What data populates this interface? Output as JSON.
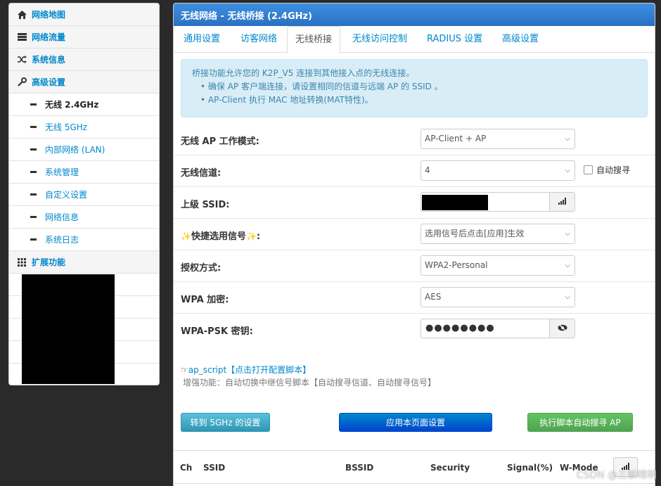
{
  "sidebar": {
    "sections": [
      {
        "label": "网络地图",
        "icon": "home-icon"
      },
      {
        "label": "网络流量",
        "icon": "list-icon"
      },
      {
        "label": "系统信息",
        "icon": "shuffle-icon"
      },
      {
        "label": "高级设置",
        "icon": "wrench-icon"
      }
    ],
    "sub_items": [
      {
        "label": "无线 2.4GHz",
        "active": true
      },
      {
        "label": "无线 5GHz"
      },
      {
        "label": "内部网络 (LAN)"
      },
      {
        "label": "系统管理"
      },
      {
        "label": "自定义设置"
      },
      {
        "label": "网络信息"
      },
      {
        "label": "系统日志"
      }
    ],
    "extension": {
      "label": "扩展功能",
      "icon": "grid-icon"
    }
  },
  "panel": {
    "title": "无线网络 - 无线桥接 (2.4GHz)",
    "tabs": [
      "通用设置",
      "访客网络",
      "无线桥接",
      "无线访问控制",
      "RADIUS 设置",
      "高级设置"
    ],
    "active_tab": "无线桥接"
  },
  "info": {
    "line1": "桥接功能允许您的 K2P_V5 连接到其他接入点的无线连接。",
    "bullet1": "确保 AP 客户端连接，请设置相同的信道与远端 AP 的 SSID 。",
    "bullet2": "AP-Client 执行 MAC 地址转换(MAT特性)。"
  },
  "form": {
    "mode_label": "无线 AP 工作模式:",
    "mode_value": "AP-Client + AP",
    "channel_label": "无线信道:",
    "channel_value": "4",
    "auto_search_label": "自动搜寻",
    "ssid_label": "上级 SSID:",
    "quick_label": "快捷选用信号",
    "quick_colon": ":",
    "quick_value": "选用信号后点击[应用]生效",
    "auth_label": "授权方式:",
    "auth_value": "WPA2-Personal",
    "wpa_label": "WPA 加密:",
    "wpa_value": "AES",
    "psk_label": "WPA-PSK 密钥:",
    "psk_value": "●●●●●●●●"
  },
  "script": {
    "link": "ap_script【点击打开配置脚本】",
    "desc": "增强功能：自动切换中继信号脚本【自动搜寻信道、自动搜寻信号】"
  },
  "buttons": {
    "goto_5g": "转到 5GHz 的设置",
    "apply": "应用本页面设置",
    "run_script": "执行脚本自动搜寻 AP"
  },
  "table": {
    "headers": [
      "Ch",
      "SSID",
      "BSSID",
      "Security",
      "Signal(%)",
      "W-Mode"
    ]
  },
  "watermark": "CSDN @三鬃晴明"
}
